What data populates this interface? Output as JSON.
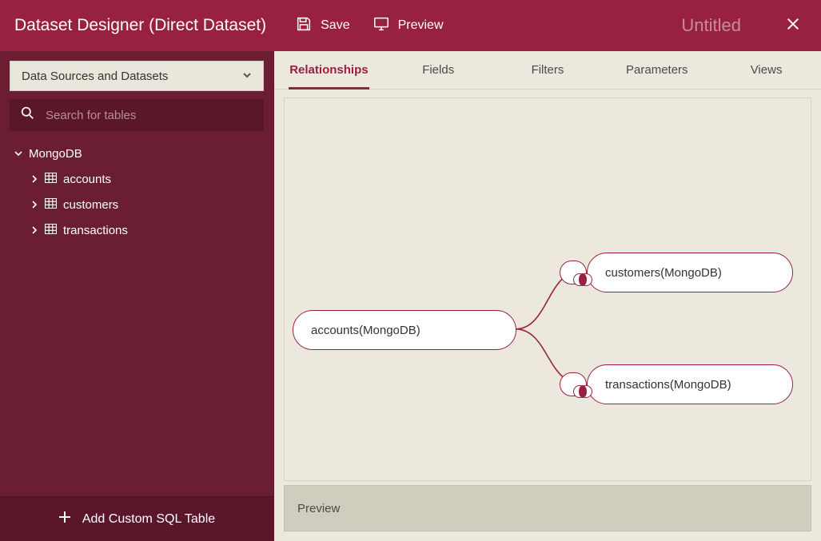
{
  "header": {
    "title": "Dataset Designer (Direct Dataset)",
    "save_label": "Save",
    "preview_label": "Preview",
    "doc_title": "Untitled"
  },
  "sidebar": {
    "dropdown_label": "Data Sources and Datasets",
    "search_placeholder": "Search for tables",
    "source_label": "MongoDB",
    "tables": [
      "accounts",
      "customers",
      "transactions"
    ],
    "add_label": "Add Custom SQL Table"
  },
  "tabs": [
    "Relationships",
    "Fields",
    "Filters",
    "Parameters",
    "Views"
  ],
  "active_tab": "Relationships",
  "canvas": {
    "nodes": {
      "accounts": "accounts(MongoDB)",
      "customers": "customers(MongoDB)",
      "transactions": "transactions(MongoDB)"
    }
  },
  "preview_label": "Preview",
  "colors": {
    "brand": "#992140"
  }
}
